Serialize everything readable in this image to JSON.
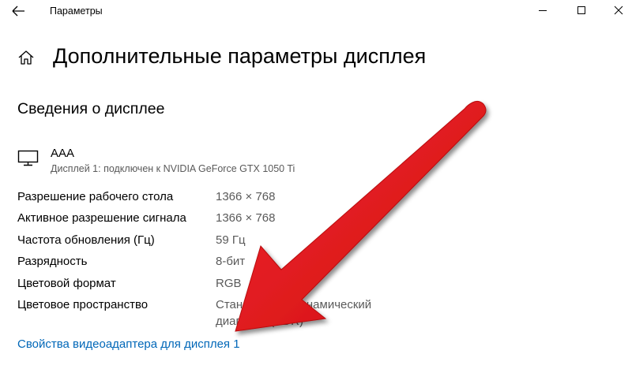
{
  "window": {
    "title": "Параметры"
  },
  "header": {
    "page_title": "Дополнительные параметры дисплея"
  },
  "section": {
    "title": "Сведения о дисплее"
  },
  "device": {
    "name": "AAA",
    "description": "Дисплей 1: подключен к NVIDIA GeForce GTX 1050 Ti"
  },
  "properties": [
    {
      "label": "Разрешение рабочего стола",
      "value": "1366 × 768"
    },
    {
      "label": "Активное разрешение сигнала",
      "value": "1366 × 768"
    },
    {
      "label": "Частота обновления (Гц)",
      "value": "59 Гц"
    },
    {
      "label": "Разрядность",
      "value": "8-бит"
    },
    {
      "label": "Цветовой формат",
      "value": "RGB"
    },
    {
      "label": "Цветовое пространство",
      "value": "Стандартный динамический",
      "value_line2": "диапазон (SDR)"
    }
  ],
  "link": {
    "adapter_properties": "Свойства видеоадаптера для дисплея 1"
  },
  "colors": {
    "link": "#0067b8",
    "secondary_text": "#5a5a5a",
    "arrow": "#e8151b"
  },
  "icons": {
    "back": "arrow-left-icon",
    "minimize": "minimize-icon",
    "maximize": "maximize-icon",
    "close": "close-icon",
    "home": "home-icon",
    "monitor": "monitor-icon",
    "annotation": "red-arrow-icon"
  }
}
